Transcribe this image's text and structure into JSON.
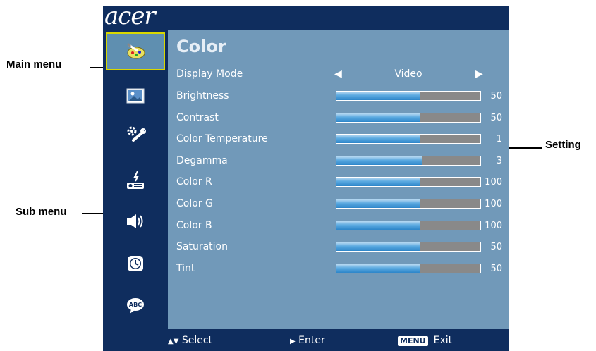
{
  "callouts": {
    "main_menu": "Main menu",
    "sub_menu": "Sub menu",
    "setting": "Setting"
  },
  "osd": {
    "logo": "acer",
    "title": "Color",
    "sidebar_icons": [
      {
        "name": "color-palette-icon",
        "active": true
      },
      {
        "name": "picture-icon",
        "active": false
      },
      {
        "name": "settings-tools-icon",
        "active": false
      },
      {
        "name": "management-icon",
        "active": false
      },
      {
        "name": "audio-speaker-icon",
        "active": false
      },
      {
        "name": "timer-clock-icon",
        "active": false
      },
      {
        "name": "language-abc-icon",
        "active": false
      }
    ],
    "display_mode": {
      "label": "Display Mode",
      "value": "Video"
    },
    "settings": [
      {
        "label": "Brightness",
        "value": "50",
        "level": 0.58
      },
      {
        "label": "Contrast",
        "value": "50",
        "level": 0.58
      },
      {
        "label": "Color Temperature",
        "value": "1",
        "level": 0.58
      },
      {
        "label": "Degamma",
        "value": "3",
        "level": 0.6
      },
      {
        "label": "Color R",
        "value": "100",
        "level": 0.58
      },
      {
        "label": "Color G",
        "value": "100",
        "level": 0.58
      },
      {
        "label": "Color B",
        "value": "100",
        "level": 0.58
      },
      {
        "label": "Saturation",
        "value": "50",
        "level": 0.58
      },
      {
        "label": "Tint",
        "value": "50",
        "level": 0.58
      }
    ],
    "footer": {
      "select": "Select",
      "enter": "Enter",
      "menu_key": "MENU",
      "exit": "Exit"
    }
  }
}
